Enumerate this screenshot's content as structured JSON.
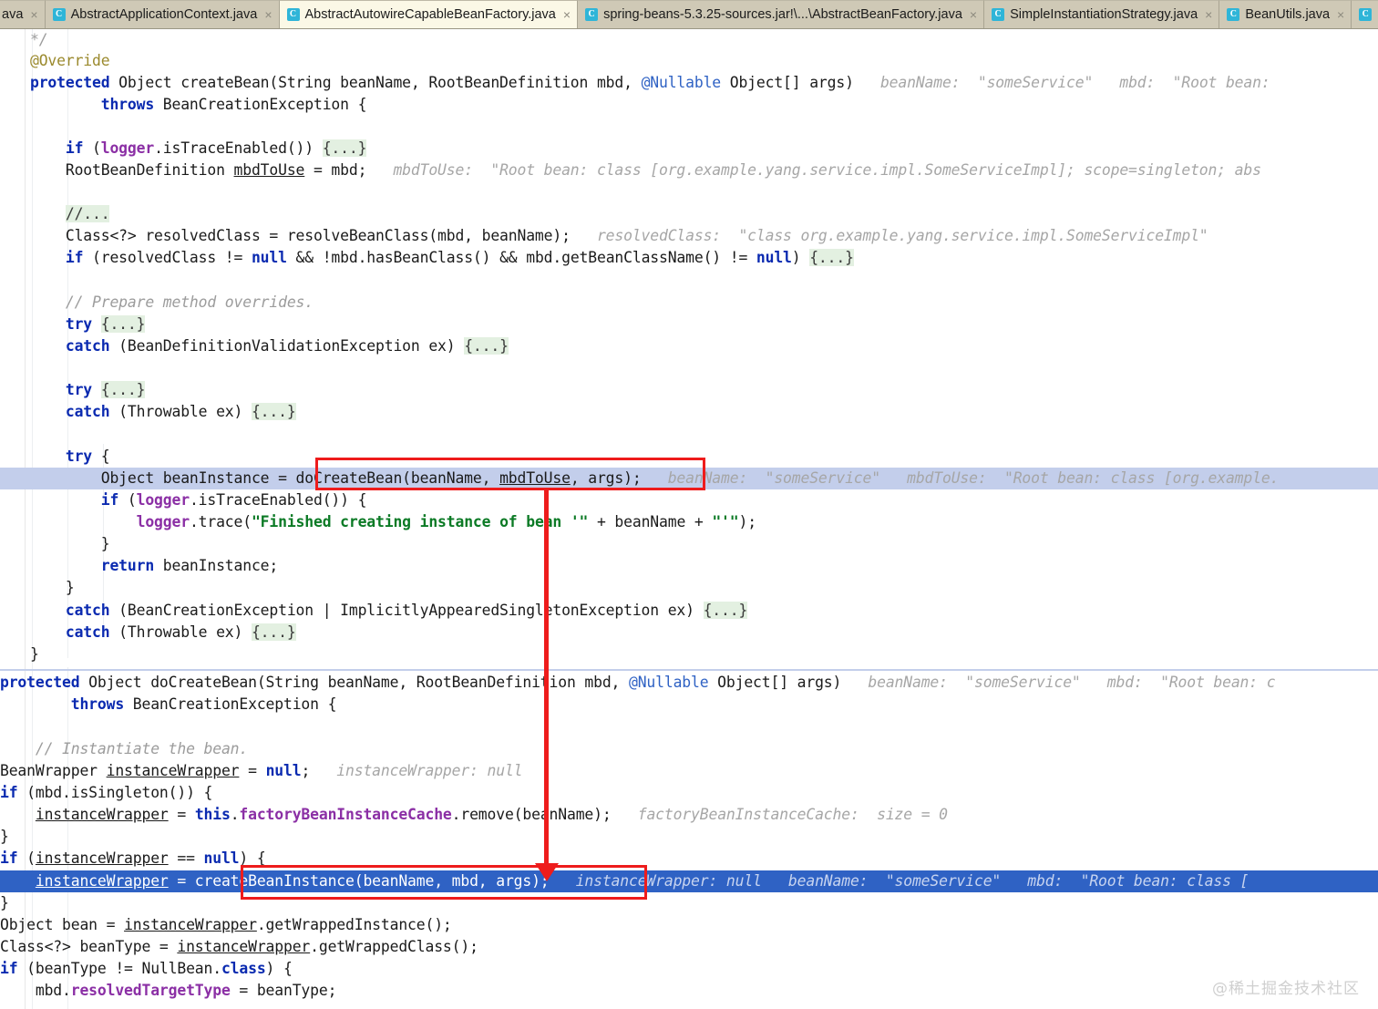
{
  "window": {
    "app": "IntelliJ IDEA",
    "kind": "java-source-editor"
  },
  "tabbar": {
    "tabs": [
      {
        "label": "ava",
        "icon": "java-class-icon",
        "close": "×",
        "active": false,
        "truncated": true
      },
      {
        "label": "AbstractApplicationContext.java",
        "icon": "java-class-icon",
        "close": "×",
        "active": false
      },
      {
        "label": "AbstractAutowireCapableBeanFactory.java",
        "icon": "java-class-icon",
        "close": "×",
        "active": true
      },
      {
        "label": "spring-beans-5.3.25-sources.jar!\\...\\AbstractBeanFactory.java",
        "icon": "java-class-icon",
        "close": "×",
        "active": false
      },
      {
        "label": "SimpleInstantiationStrategy.java",
        "icon": "java-class-icon",
        "close": "×",
        "active": false
      },
      {
        "label": "BeanUtils.java",
        "icon": "java-class-icon",
        "close": "×",
        "active": false
      },
      {
        "label": "",
        "icon": "java-class-icon",
        "close": "",
        "active": false,
        "truncated": true
      }
    ]
  },
  "code": {
    "lines": [
      "*/",
      "@Override",
      "protected Object createBean(String beanName, RootBeanDefinition mbd, @Nullable Object[] args)",
      "        throws BeanCreationException {",
      "",
      "    if (logger.isTraceEnabled()) {...}",
      "    RootBeanDefinition mbdToUse = mbd;",
      "",
      "    //...",
      "    Class<?> resolvedClass = resolveBeanClass(mbd, beanName);",
      "    if (resolvedClass != null && !mbd.hasBeanClass() && mbd.getBeanClassName() != null) {...}",
      "",
      "    // Prepare method overrides.",
      "    try {...}",
      "    catch (BeanDefinitionValidationException ex) {...}",
      "",
      "    try {...}",
      "    catch (Throwable ex) {...}",
      "",
      "    try {",
      "        Object beanInstance = doCreateBean(beanName, mbdToUse, args);",
      "        if (logger.isTraceEnabled()) {",
      "            logger.trace(\"Finished creating instance of bean '\" + beanName + \"'\");",
      "        }",
      "        return beanInstance;",
      "    }",
      "    catch (BeanCreationException | ImplicitlyAppearedSingletonException ex) {...}",
      "    catch (Throwable ex) {...}",
      "}",
      "protected Object doCreateBean(String beanName, RootBeanDefinition mbd, @Nullable Object[] args)",
      "        throws BeanCreationException {",
      "",
      "    // Instantiate the bean.",
      "    BeanWrapper instanceWrapper = null;",
      "    if (mbd.isSingleton()) {",
      "        instanceWrapper = this.factoryBeanInstanceCache.remove(beanName);",
      "    }",
      "    if (instanceWrapper == null) {",
      "        instanceWrapper = createBeanInstance(beanName, mbd, args);",
      "    }",
      "    Object bean = instanceWrapper.getWrappedInstance();",
      "    Class<?> beanType = instanceWrapper.getWrappedClass();",
      "    if (beanType != NullBean.class) {",
      "        mbd.resolvedTargetType = beanType;"
    ],
    "inlay_hints": {
      "create_bean_sig_beanname": "beanName:  \"someService\"",
      "create_bean_sig_mbd": "mbd:  \"Root bean:",
      "mbd_to_use": "mbdToUse:  \"Root bean: class [org.example.yang.service.impl.SomeServiceImpl]; scope=singleton; abs",
      "resolved_class": "resolvedClass:  \"class org.example.yang.service.impl.SomeServiceImpl\"",
      "do_create_bean_call_beanname": "beanName:  \"someService\"",
      "do_create_bean_call_mbdtouse": "mbdToUse:  \"Root bean: class [org.example.",
      "do_create_bean_sig_beanname": "beanName:  \"someService\"",
      "do_create_bean_sig_mbd": "mbd:  \"Root bean: c",
      "instance_wrapper_null": "instanceWrapper: null",
      "factory_bean_instance_cache": "factoryBeanInstanceCache:  size = 0",
      "create_bean_instance_iw": "instanceWrapper: null",
      "create_bean_instance_beanname": "beanName:  \"someService\"",
      "create_bean_instance_mbd": "mbd:  \"Root bean: class ["
    }
  },
  "annotations": {
    "box_do_create_bean": "red-highlight-box-do-create-bean",
    "box_create_bean_instance": "red-highlight-box-create-bean-instance",
    "arrow": "red-down-arrow"
  },
  "watermark": {
    "text": "@稀土掘金技术社区"
  },
  "colors": {
    "tabbar_bg": "#d9d4c3",
    "active_tab_bg": "#fbf8e6",
    "caret_line": "#c3ceeb",
    "selection": "#2f62c4",
    "keyword": "#0a2ab0",
    "string": "#0b7a25",
    "comment": "#9c9c9c",
    "field": "#8b2fa5",
    "annotation_red": "#ee1c1c",
    "fold_bg": "#e3f0e1"
  }
}
